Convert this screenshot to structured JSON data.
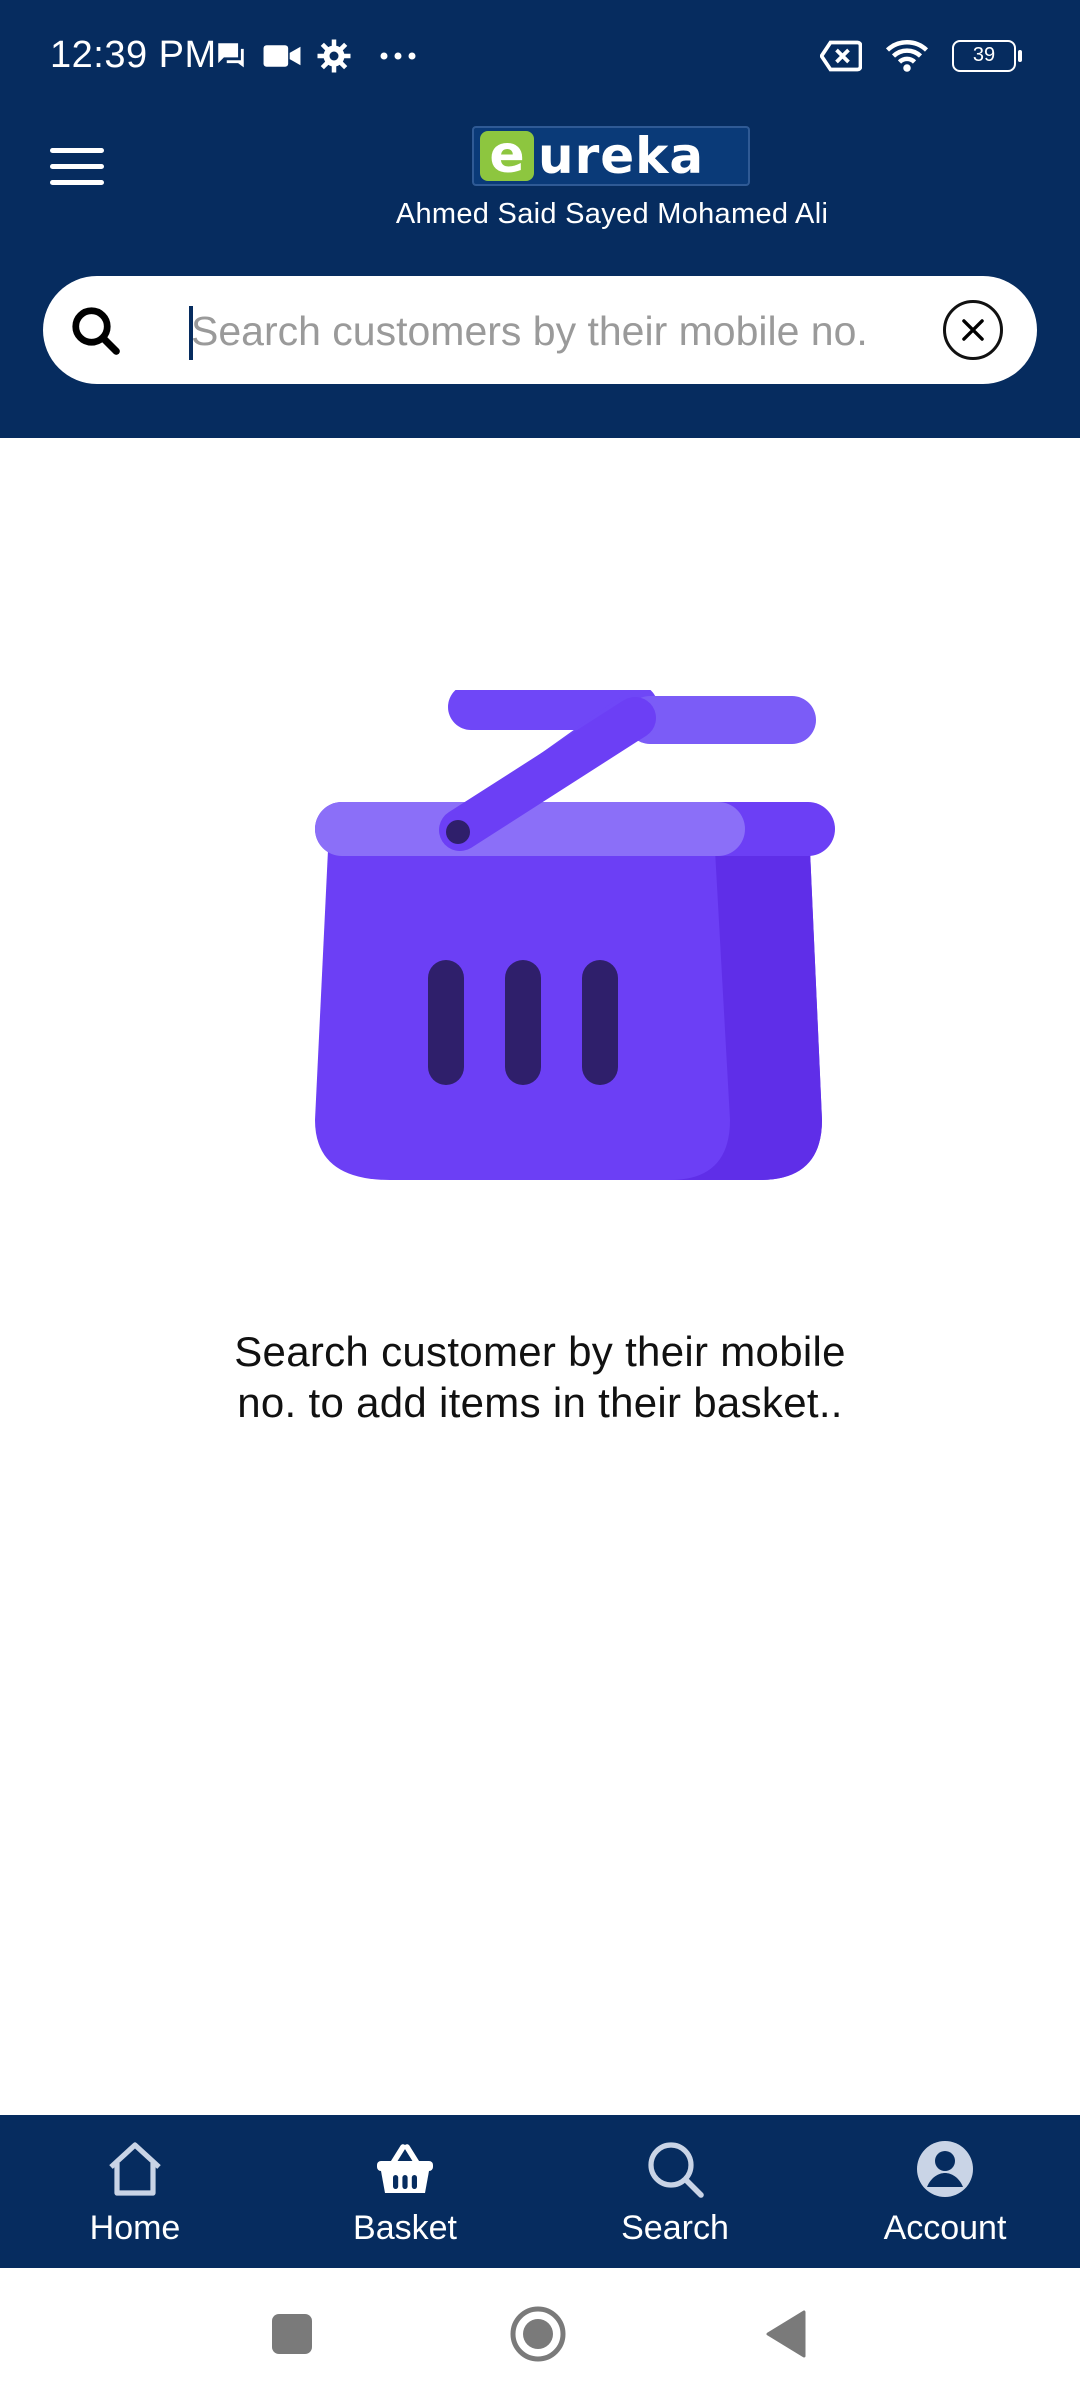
{
  "status_bar": {
    "time": "12:39 PM",
    "battery": "39",
    "icons_left": [
      "chat-icon",
      "video-camera-icon",
      "settings-icon",
      "more-dots-icon"
    ],
    "icons_right": [
      "sim-off-icon",
      "wifi-icon",
      "battery-icon"
    ]
  },
  "header": {
    "logo_e": "e",
    "logo_rest": "ureka",
    "user_name": "Ahmed Said Sayed Mohamed Ali",
    "menu_icon": "hamburger-menu-icon",
    "background_color": "#062c5f"
  },
  "search": {
    "placeholder": "Search customers by their mobile no.",
    "value": "",
    "search_icon": "search-icon",
    "clear_icon": "close-circle-icon"
  },
  "empty_state": {
    "illustration": "basket-icon",
    "message": "Search customer by their mobile no. to add items in their basket.."
  },
  "bottom_nav": {
    "items": [
      {
        "label": "Home",
        "icon": "home-icon",
        "active": false
      },
      {
        "label": "Basket",
        "icon": "basket-icon",
        "active": true
      },
      {
        "label": "Search",
        "icon": "search-icon",
        "active": false
      },
      {
        "label": "Account",
        "icon": "account-icon",
        "active": false
      }
    ]
  },
  "system_nav": {
    "buttons": [
      "recents-square-icon",
      "home-circle-icon",
      "back-triangle-icon"
    ]
  },
  "colors": {
    "primary": "#062c5f",
    "basket_purple": "#6c3ff5",
    "logo_green": "#8dc63f"
  }
}
